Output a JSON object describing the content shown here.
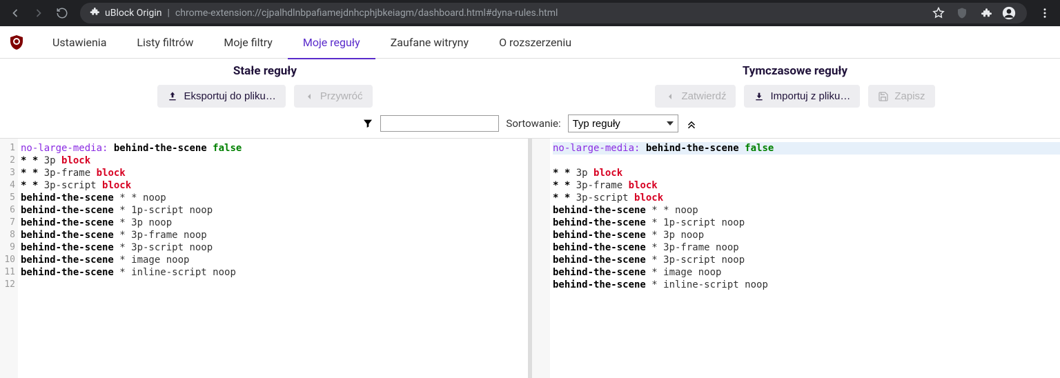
{
  "browser": {
    "ext_name": "uBlock Origin",
    "url": "chrome-extension://cjpalhdlnbpafiamejdnhcphjbkeiagm/dashboard.html#dyna-rules.html"
  },
  "tabs": {
    "settings": "Ustawienia",
    "filter_lists": "Listy filtrów",
    "my_filters": "Moje filtry",
    "my_rules": "Moje reguły",
    "trusted": "Zaufane witryny",
    "about": "O rozszerzeniu"
  },
  "panel": {
    "permanent_title": "Stałe reguły",
    "temporary_title": "Tymczasowe reguły",
    "export_btn": "Eksportuj do pliku…",
    "revert_btn": "Przywróć",
    "commit_btn": "Zatwierdź",
    "import_btn": "Importuj z pliku…",
    "save_btn": "Zapisz",
    "sort_label": "Sortowanie:",
    "sort_value": "Typ reguły",
    "filter_placeholder": ""
  },
  "rules": [
    {
      "d": "no-large-media:",
      "h": "behind-the-scene",
      "a": "false"
    },
    {
      "h": "* *",
      "t": "3p",
      "a": "block"
    },
    {
      "h": "* *",
      "t": "3p-frame",
      "a": "block"
    },
    {
      "h": "* *",
      "t": "3p-script",
      "a": "block"
    },
    {
      "h": "behind-the-scene",
      "t": "* *",
      "a": "noop"
    },
    {
      "h": "behind-the-scene",
      "t": "* 1p-script",
      "a": "noop"
    },
    {
      "h": "behind-the-scene",
      "t": "* 3p",
      "a": "noop"
    },
    {
      "h": "behind-the-scene",
      "t": "* 3p-frame",
      "a": "noop"
    },
    {
      "h": "behind-the-scene",
      "t": "* 3p-script",
      "a": "noop"
    },
    {
      "h": "behind-the-scene",
      "t": "* image",
      "a": "noop"
    },
    {
      "h": "behind-the-scene",
      "t": "* inline-script",
      "a": "noop"
    }
  ]
}
